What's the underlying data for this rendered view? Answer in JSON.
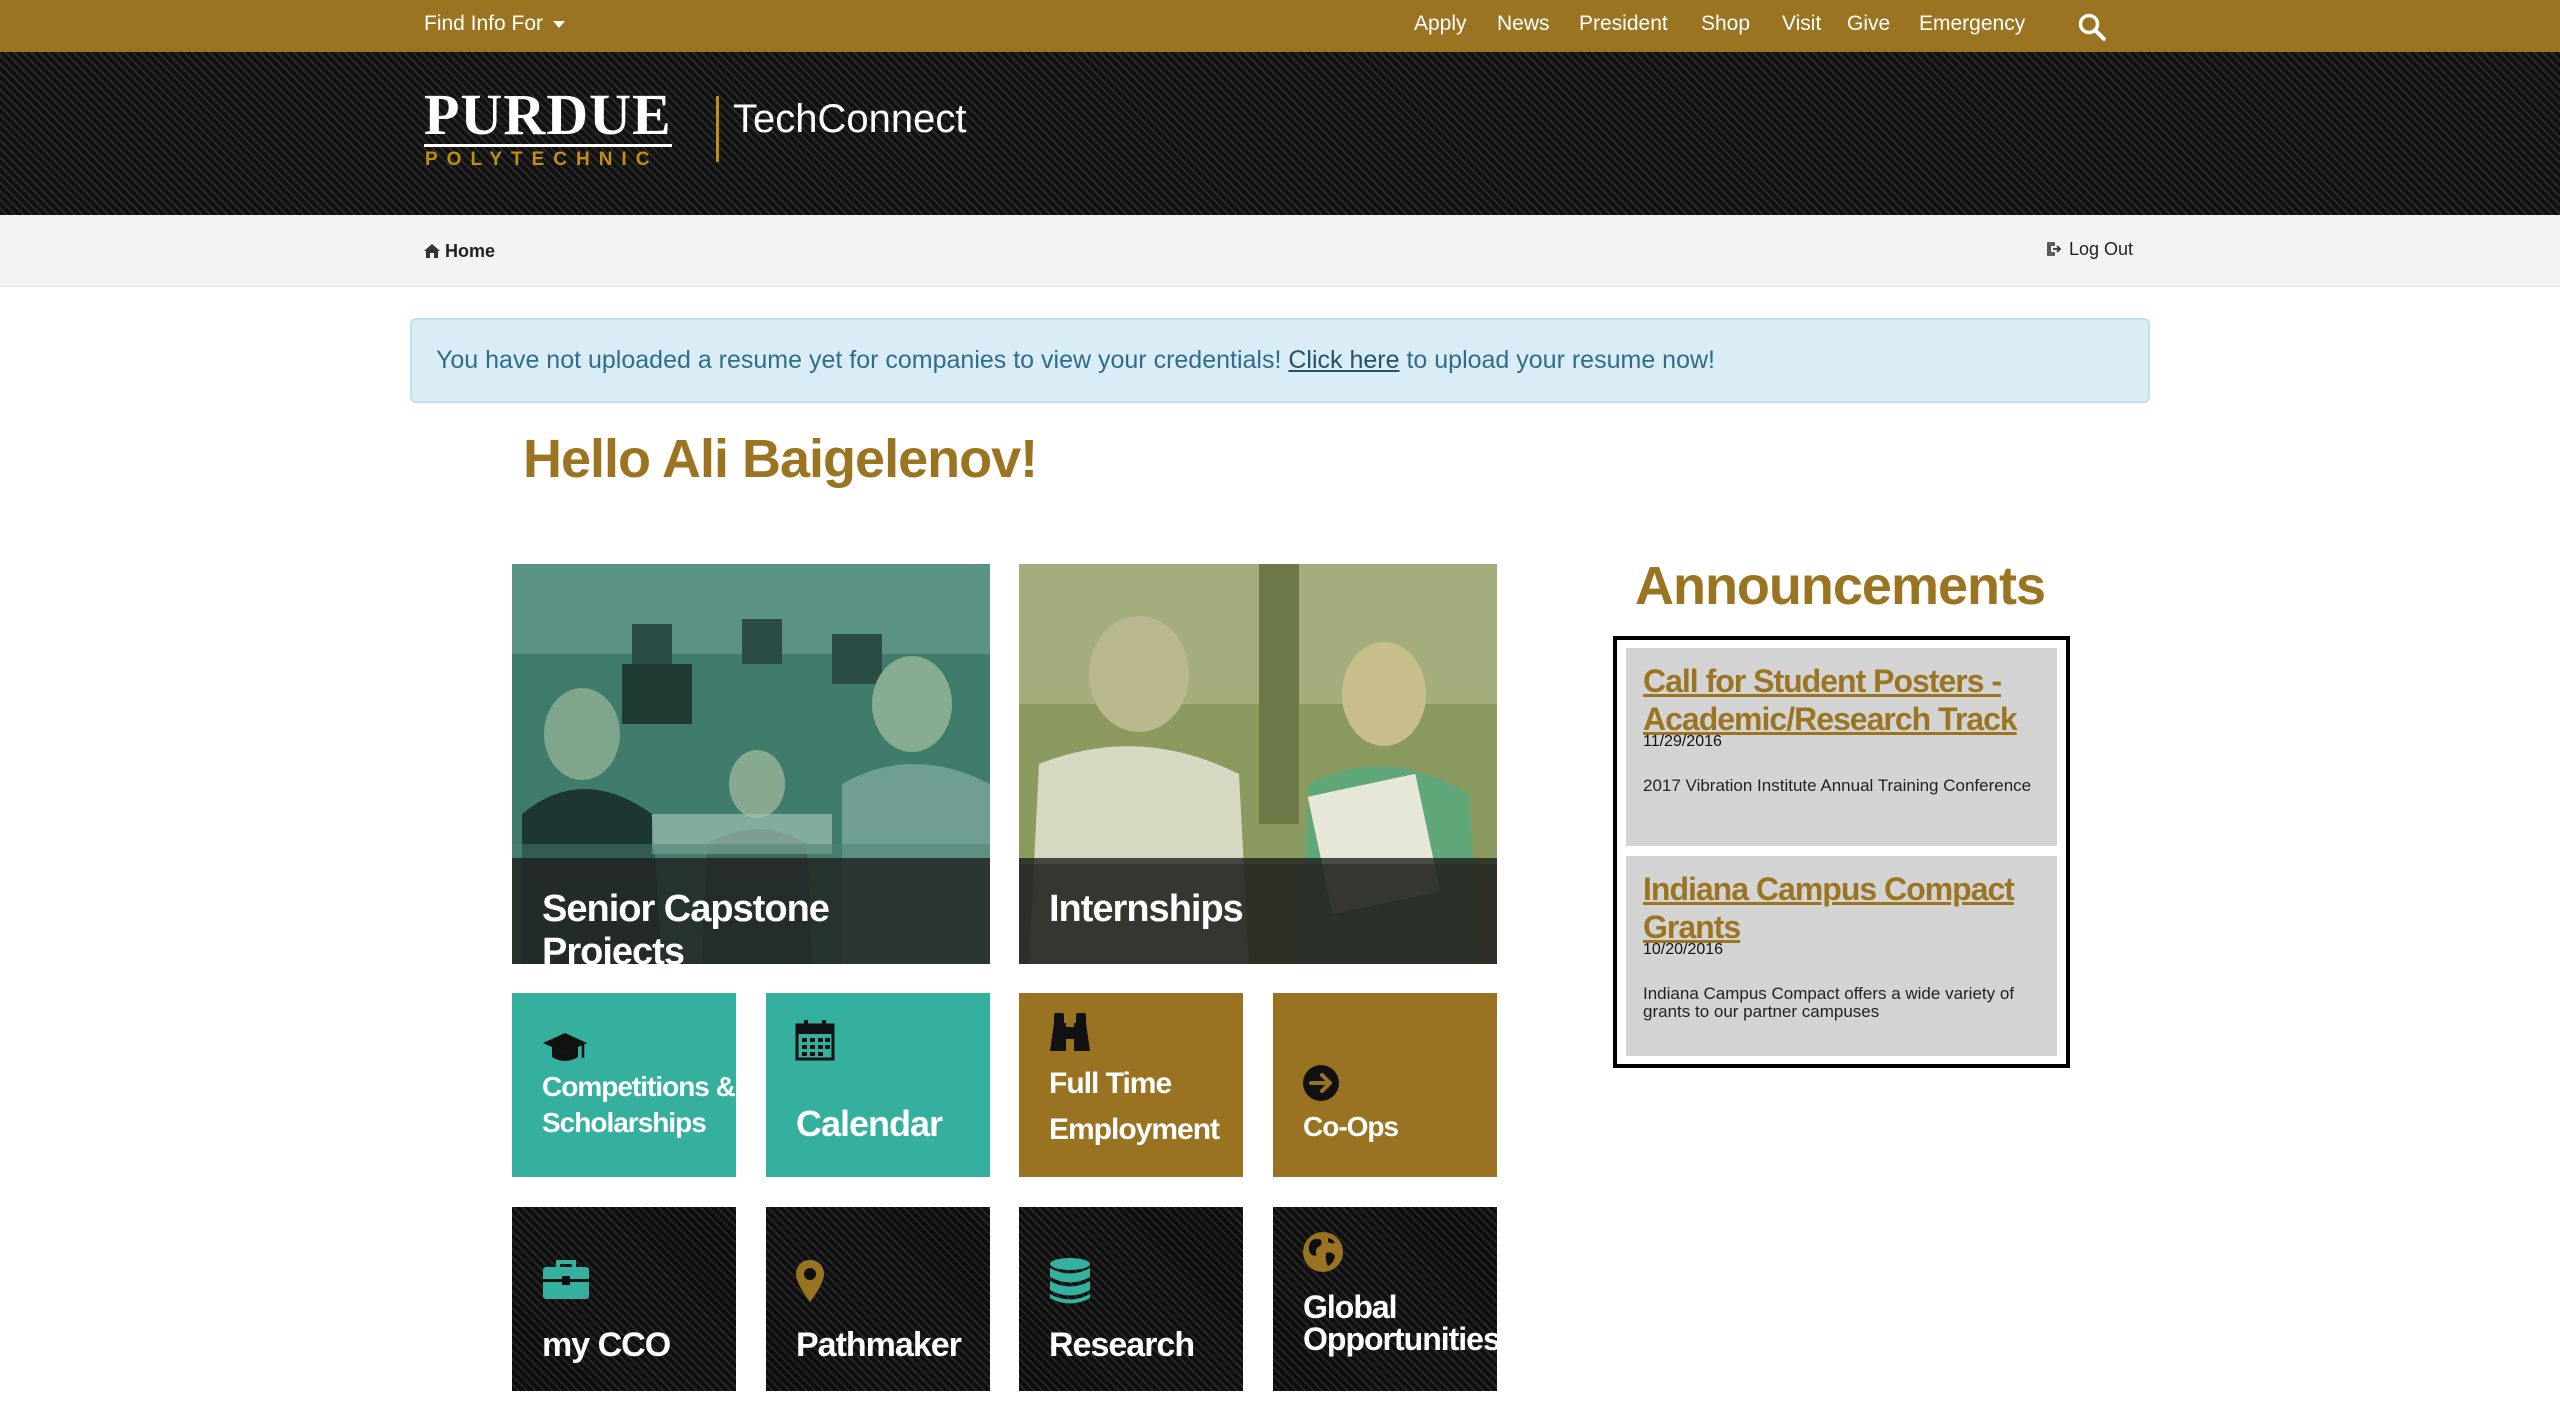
{
  "topbar": {
    "find_info": "Find Info For",
    "nav": [
      "Apply",
      "News",
      "President",
      "Shop",
      "Visit",
      "Give",
      "Emergency"
    ]
  },
  "header": {
    "logo_main": "PURDUE",
    "logo_sub": "POLYTECHNIC",
    "app_name": "TechConnect"
  },
  "breadcrumb": {
    "home": "Home",
    "logout": "Log Out"
  },
  "alert": {
    "before": "You have not uploaded a resume yet for companies to view your credentials! ",
    "link": "Click here",
    "after": " to upload your resume now!"
  },
  "greeting": "Hello Ali Baigelenov!",
  "photo_tiles": [
    {
      "label": "Senior Capstone Projects"
    },
    {
      "label": "Internships"
    }
  ],
  "tiles": [
    {
      "line1": "Competitions &",
      "line2": "Scholarships",
      "icon": "graduation-cap-icon",
      "color": "#35b09f"
    },
    {
      "line1": "Calendar",
      "line2": "",
      "icon": "calendar-icon",
      "color": "#35b09f"
    },
    {
      "line1": "Full Time",
      "line2": "Employment",
      "icon": "binoculars-icon",
      "color": "#997321"
    },
    {
      "line1": "Co-Ops",
      "line2": "",
      "icon": "arrow-circle-right-icon",
      "color": "#997321"
    },
    {
      "line1": "my CCO",
      "line2": "",
      "icon": "briefcase-icon",
      "color": "#35b09f"
    },
    {
      "line1": "Pathmaker",
      "line2": "",
      "icon": "map-marker-icon",
      "color": "#997321"
    },
    {
      "line1": "Research",
      "line2": "",
      "icon": "database-icon",
      "color": "#35b09f"
    },
    {
      "line1": "Global",
      "line2": "Opportunities",
      "icon": "globe-icon",
      "color": "#997321"
    }
  ],
  "announcements": {
    "title": "Announcements",
    "items": [
      {
        "title": "Call for Student Posters - Academic/Research Track",
        "date": "11/29/2016",
        "description": "2017 Vibration Institute Annual Training Conference"
      },
      {
        "title": "Indiana Campus Compact Grants",
        "date": "10/20/2016",
        "description": "Indiana Campus Compact offers a wide variety of grants to our partner campuses"
      }
    ]
  },
  "colors": {
    "gold": "#9a7420",
    "teal": "#35b09f",
    "tile_gold": "#997321",
    "alert_bg": "#daedf7"
  }
}
